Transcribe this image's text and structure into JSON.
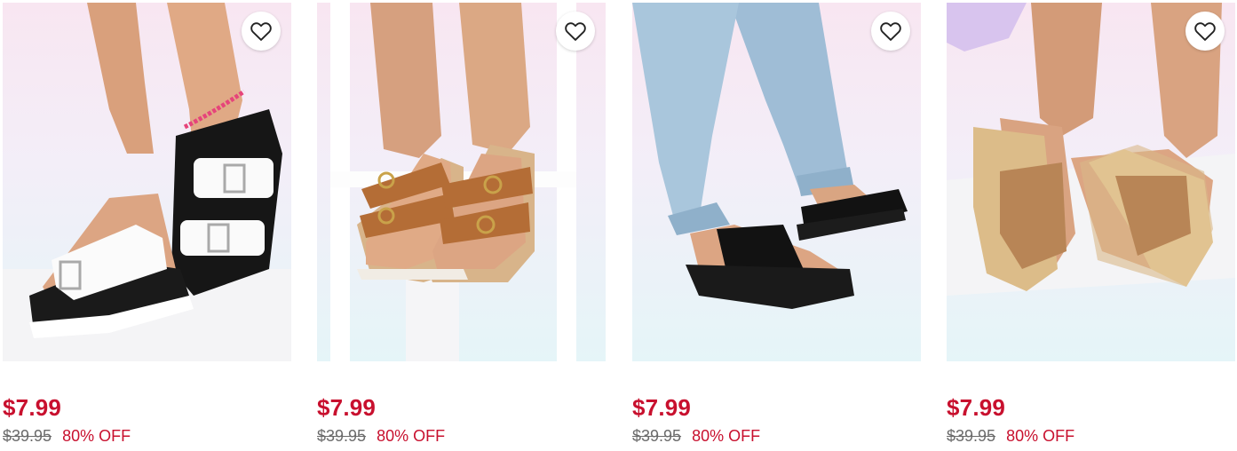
{
  "products": [
    {
      "price": "$7.99",
      "original_price": "$39.95",
      "discount": "80% OFF",
      "image_alt": "white double-buckle sandal",
      "colors": {
        "accent": "#ffffff"
      }
    },
    {
      "price": "$7.99",
      "original_price": "$39.95",
      "discount": "80% OFF",
      "image_alt": "tan double-buckle footbed sandal",
      "colors": {
        "accent": "#b06a34"
      }
    },
    {
      "price": "$7.99",
      "original_price": "$39.95",
      "discount": "80% OFF",
      "image_alt": "black platform slide sandal",
      "colors": {
        "accent": "#111111"
      }
    },
    {
      "price": "$7.99",
      "original_price": "$39.95",
      "discount": "80% OFF",
      "image_alt": "tan espadrille platform slide",
      "colors": {
        "accent": "#b8875a"
      }
    }
  ],
  "icons": {
    "favorite": "heart-outline-icon"
  },
  "colors": {
    "sale": "#c8102e",
    "strike": "#6b6b6b"
  }
}
